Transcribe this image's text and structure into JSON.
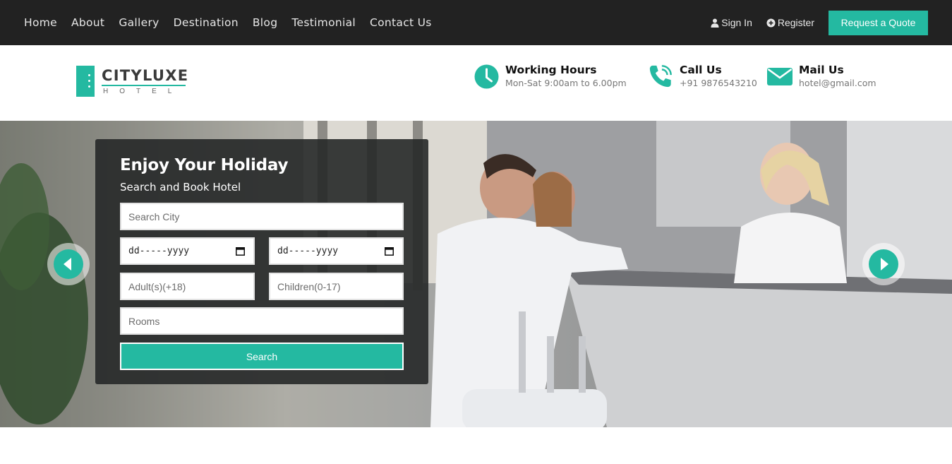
{
  "nav": {
    "links": [
      "Home",
      "About",
      "Gallery",
      "Destination",
      "Blog",
      "Testimonial",
      "Contact Us"
    ],
    "sign_in": "Sign In",
    "register": "Register",
    "quote_button": "Request a Quote"
  },
  "brand": {
    "name": "CITYLUXE",
    "tagline": "HOTEL",
    "accent_color": "#24b9a1"
  },
  "contact": {
    "hours": {
      "title": "Working Hours",
      "value": "Mon-Sat 9:00am to 6.00pm",
      "icon": "clock-icon"
    },
    "phone": {
      "title": "Call Us",
      "value": "+91 9876543210",
      "icon": "phone-icon"
    },
    "mail": {
      "title": "Mail Us",
      "value": "hotel@gmail.com",
      "icon": "envelope-icon"
    }
  },
  "booking": {
    "title": "Enjoy Your Holiday",
    "subtitle": "Search and Book Hotel",
    "city_placeholder": "Search City",
    "checkin_value": "dd-----yyyy",
    "checkout_value": "dd-----yyyy",
    "adults_placeholder": "Adult(s)(+18)",
    "children_placeholder": "Children(0-17)",
    "rooms_placeholder": "Rooms",
    "search_label": "Search"
  },
  "colors": {
    "topbar": "#222222",
    "accent": "#24b9a1",
    "panel": "#262828"
  }
}
